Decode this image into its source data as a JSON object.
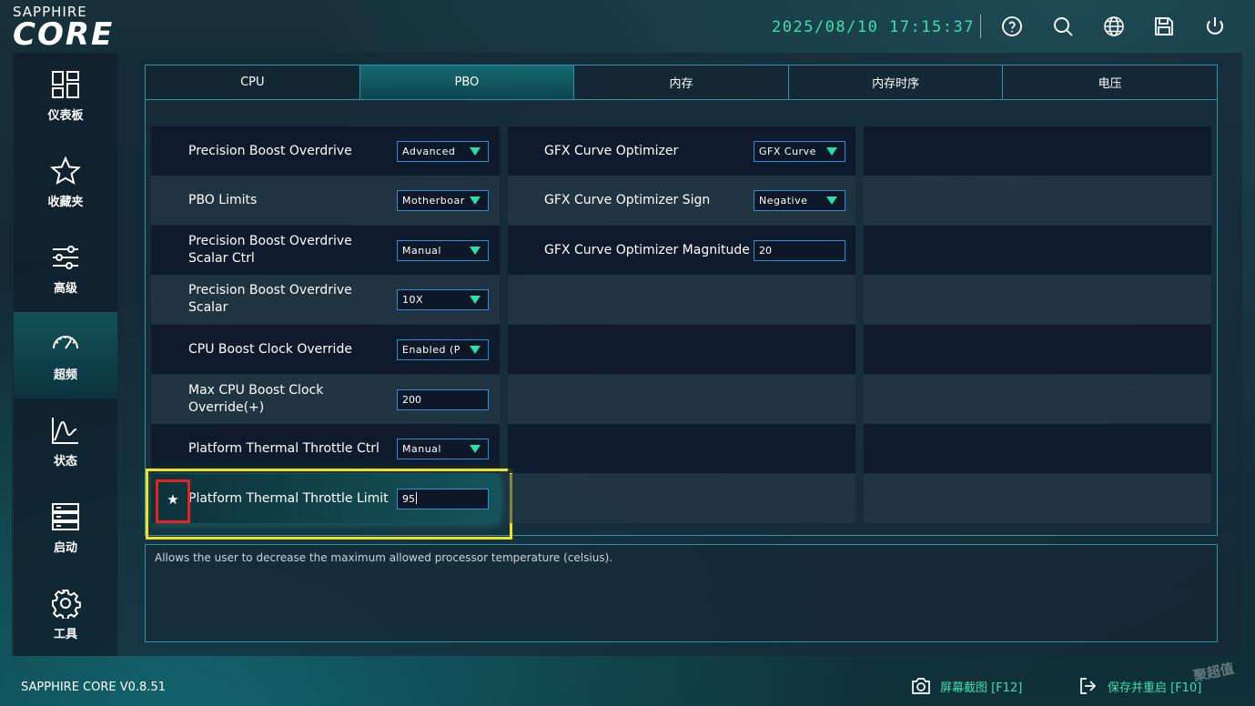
{
  "header": {
    "brand_small": "SAPPHIRE",
    "brand_large": "CORE",
    "datetime": "2025/08/10 17:15:37",
    "icons": [
      "help-icon",
      "search-icon",
      "globe-icon",
      "save-icon",
      "power-icon"
    ]
  },
  "sidebar": {
    "items": [
      {
        "label": "仪表板",
        "icon": "dashboard-icon",
        "active": false
      },
      {
        "label": "收藏夹",
        "icon": "star-icon",
        "active": false
      },
      {
        "label": "高级",
        "icon": "sliders-icon",
        "active": false
      },
      {
        "label": "超频",
        "icon": "speedometer-icon",
        "active": true
      },
      {
        "label": "状态",
        "icon": "chart-icon",
        "active": false
      },
      {
        "label": "启动",
        "icon": "boot-icon",
        "active": false
      },
      {
        "label": "工具",
        "icon": "gear-icon",
        "active": false
      }
    ]
  },
  "tabs": [
    {
      "label": "CPU",
      "active": false
    },
    {
      "label": "PBO",
      "active": true
    },
    {
      "label": "内存",
      "active": false
    },
    {
      "label": "内存时序",
      "active": false
    },
    {
      "label": "电压",
      "active": false
    }
  ],
  "settings": {
    "col1": [
      {
        "label": "Precision Boost Overdrive",
        "type": "dropdown",
        "value": "Advanced"
      },
      {
        "label": "PBO Limits",
        "type": "dropdown",
        "value": "Motherboar"
      },
      {
        "label": "Precision Boost Overdrive Scalar Ctrl",
        "type": "dropdown",
        "value": "Manual"
      },
      {
        "label": "Precision Boost Overdrive Scalar",
        "type": "dropdown",
        "value": "10X"
      },
      {
        "label": "CPU Boost Clock Override",
        "type": "dropdown",
        "value": "Enabled (P"
      },
      {
        "label": "Max CPU Boost Clock Override(+)",
        "type": "input",
        "value": "200"
      },
      {
        "label": "Platform Thermal Throttle Ctrl",
        "type": "dropdown",
        "value": "Manual"
      },
      {
        "label": "Platform Thermal Throttle Limit",
        "type": "input",
        "value": "95"
      }
    ],
    "col2": [
      {
        "label": "GFX Curve Optimizer",
        "type": "dropdown",
        "value": "GFX Curve"
      },
      {
        "label": "GFX Curve Optimizer Sign",
        "type": "dropdown",
        "value": "Negative"
      },
      {
        "label": "GFX Curve Optimizer Magnitude",
        "type": "input",
        "value": "20"
      }
    ]
  },
  "description": "Allows the user to decrease the maximum allowed processor temperature (celsius).",
  "footer": {
    "version": "SAPPHIRE CORE V0.8.51",
    "screenshot_label": "屏幕截图 [F12]",
    "save_restart_label": "保存并重启 [F10]",
    "watermark": "聚超值"
  },
  "colors": {
    "accent_green": "#3de0b0",
    "tab_border": "#2b93a8",
    "field_border": "#2f8fd0",
    "highlight_yellow": "#f4e11d",
    "highlight_red": "#e8231f"
  }
}
